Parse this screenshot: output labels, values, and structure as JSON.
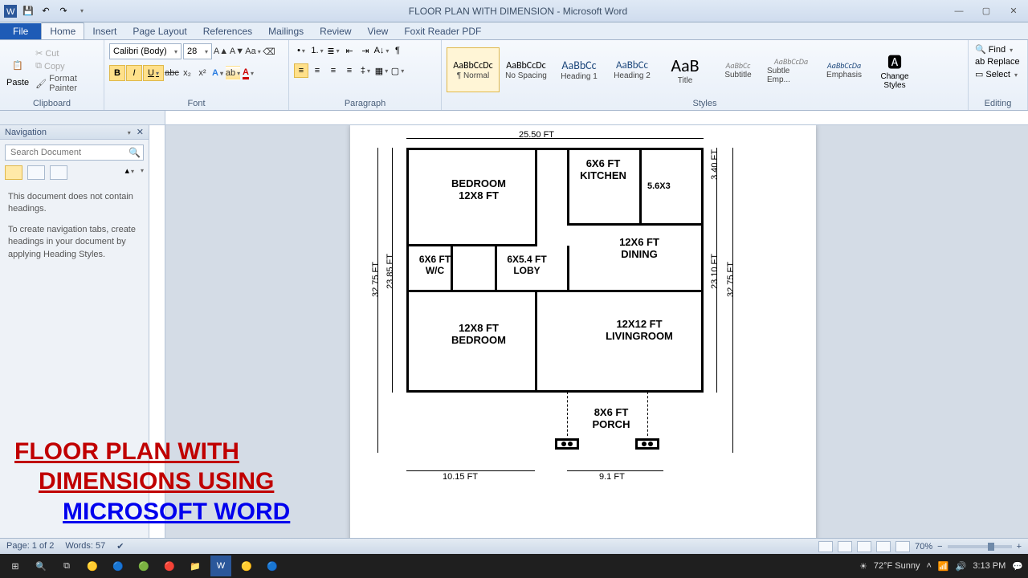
{
  "app": {
    "doc_title": "FLOOR PLAN WITH DIMENSION",
    "app_name": "Microsoft Word",
    "full_title": "FLOOR PLAN WITH DIMENSION - Microsoft Word"
  },
  "tabs": {
    "file": "File",
    "items": [
      "Home",
      "Insert",
      "Page Layout",
      "References",
      "Mailings",
      "Review",
      "View",
      "Foxit Reader PDF"
    ],
    "active": "Home"
  },
  "clipboard": {
    "paste": "Paste",
    "cut": "Cut",
    "copy": "Copy",
    "format_painter": "Format Painter",
    "group": "Clipboard"
  },
  "font": {
    "name": "Calibri (Body)",
    "size": "28",
    "group": "Font"
  },
  "paragraph": {
    "group": "Paragraph"
  },
  "styles": {
    "group": "Styles",
    "items": [
      {
        "preview": "AaBbCcDc",
        "name": "¶ Normal",
        "cls": "normal",
        "selected": true
      },
      {
        "preview": "AaBbCcDc",
        "name": "No Spacing",
        "cls": "nospace"
      },
      {
        "preview": "AaBbCc",
        "name": "Heading 1",
        "cls": "h1"
      },
      {
        "preview": "AaBbCc",
        "name": "Heading 2",
        "cls": "h2"
      },
      {
        "preview": "AaB",
        "name": "Title",
        "cls": "titlebig"
      },
      {
        "preview": "AaBbCc",
        "name": "Subtitle",
        "cls": "sub"
      },
      {
        "preview": "AaBbCcDa",
        "name": "Subtle Emp...",
        "cls": "sub"
      },
      {
        "preview": "AaBbCcDa",
        "name": "Emphasis",
        "cls": "emp"
      }
    ],
    "change": "Change Styles"
  },
  "editing": {
    "find": "Find",
    "replace": "Replace",
    "select": "Select",
    "group": "Editing"
  },
  "nav": {
    "title": "Navigation",
    "placeholder": "Search Document",
    "msg1": "This document does not contain headings.",
    "msg2": "To create navigation tabs, create headings in your document by applying Heading Styles."
  },
  "plan": {
    "top_dim": "25.50 FT",
    "right_top": "3.40 FT",
    "kitchen_dim": "6X6 FT",
    "kitchen": "KITCHEN",
    "bath": "5.6X3",
    "bed1_name": "BEDROOM",
    "bed1_dim": "12X8 FT",
    "dining_dim": "12X6 FT",
    "dining": "DINING",
    "wc_dim": "6X6 FT",
    "wc": "W/C",
    "loby_dim": "6X5.4 FT",
    "loby": "LOBY",
    "bed2_dim": "12X8 FT",
    "bed2_name": "BEDROOM",
    "living_dim": "12X12 FT",
    "living": "LIVINGROOM",
    "porch_dim": "8X6 FT",
    "porch": "PORCH",
    "left_outer": "32.75 FT",
    "left_inner": "23.85 FT",
    "right_inner": "23.10 FT",
    "right_outer": "32.75 FT",
    "bottom_left": "10.15 FT",
    "bottom_right": "9.1 FT"
  },
  "overlay": {
    "line1": "FLOOR PLAN WITH",
    "line2": "DIMENSIONS USING",
    "line3": "MICROSOFT WORD"
  },
  "status": {
    "page": "Page: 1 of 2",
    "words": "Words: 57",
    "zoom": "70%"
  },
  "tray": {
    "weather": "72°F Sunny",
    "time": "3:13 PM"
  }
}
